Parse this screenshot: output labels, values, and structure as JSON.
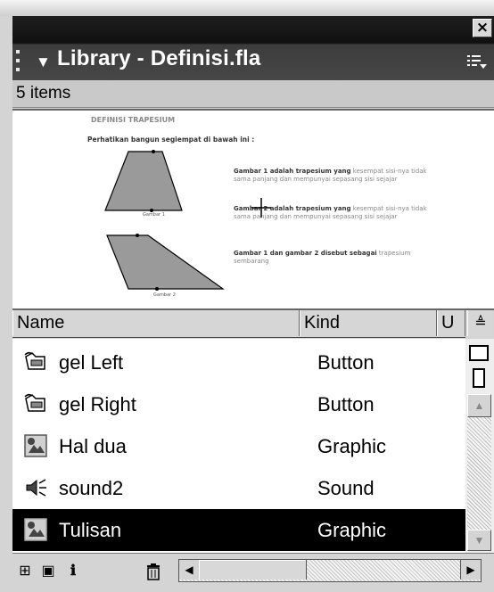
{
  "window": {
    "close_glyph": "×"
  },
  "panel": {
    "title": "Library - Definisi.fla",
    "collapse_glyph": "▼",
    "menu_glyph": "☰",
    "item_count": "5 items"
  },
  "preview": {
    "title": "DEFINISI TRAPESIUM",
    "instruction": "Perhatikan bangun segiempat di bawah ini :",
    "caption1": "Gambar 1",
    "caption2": "Gambar 2",
    "para1_bold": "Gambar 1 adalah trapesium yang",
    "para1_rest": " kesempat sisi-nya tidak sama panjang dan mempunyai sepasang sisi sejajar",
    "para2_bold": "Gambar 2 adalah trapesium yang",
    "para2_rest": " kesempat sisi-nya tidak sama panjang dan mempunyai sepasang sisi sejajar",
    "para3_bold": "Gambar 1 dan gambar 2 disebut sebagai",
    "para3_rest": " trapesium sembarang"
  },
  "columns": {
    "name": "Name",
    "kind": "Kind",
    "u": "U",
    "sort_glyph": "≜"
  },
  "items": [
    {
      "name": "gel Left",
      "kind": "Button",
      "icon": "button-symbol-icon"
    },
    {
      "name": "gel Right",
      "kind": "Button",
      "icon": "button-symbol-icon"
    },
    {
      "name": "Hal dua",
      "kind": "Graphic",
      "icon": "graphic-symbol-icon"
    },
    {
      "name": "sound2",
      "kind": "Sound",
      "icon": "sound-icon"
    },
    {
      "name": "Tulisan",
      "kind": "Graphic",
      "icon": "graphic-symbol-icon",
      "selected": true
    }
  ],
  "toolbar": {
    "new_symbol": "⊞",
    "new_folder": "▣",
    "properties": "ℹ",
    "delete": "🗑"
  },
  "colors": {
    "selection": "#000000",
    "titlebar": "#2b2b2b",
    "preview_bg": "#ffffff"
  }
}
